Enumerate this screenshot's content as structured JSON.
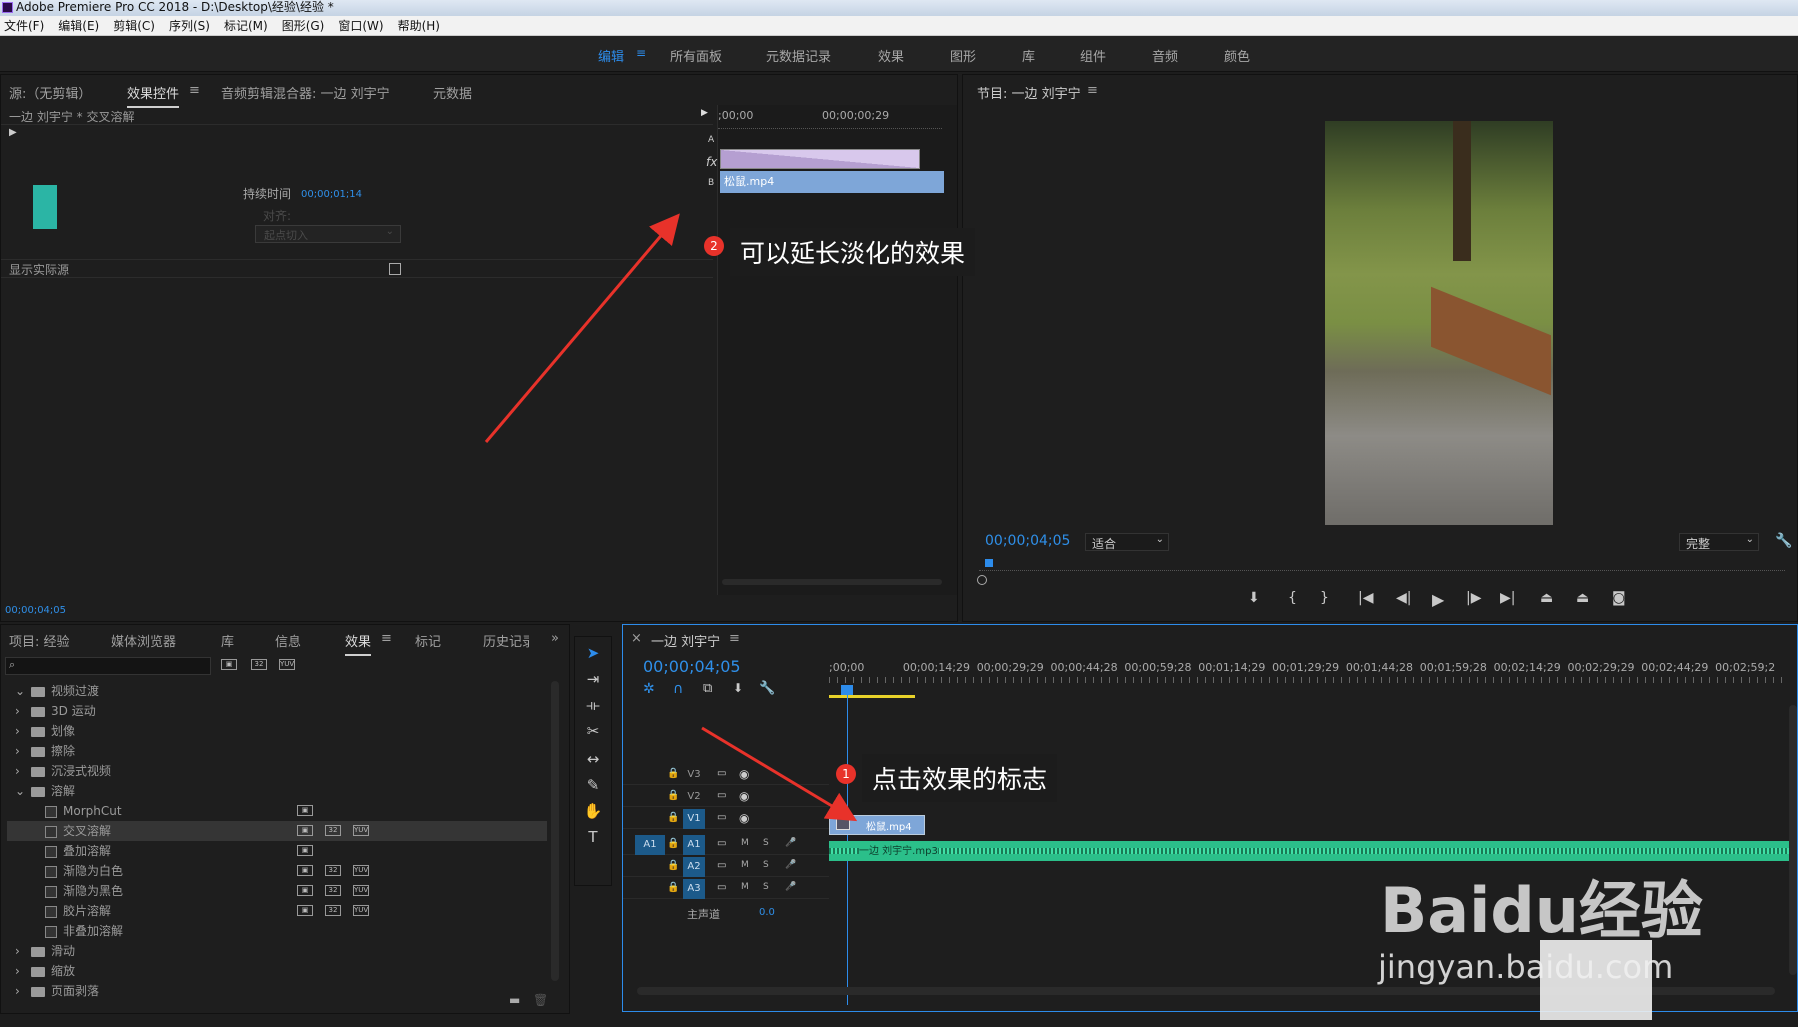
{
  "window": {
    "title": "Adobe Premiere Pro CC 2018 - D:\\Desktop\\经验\\经验 *"
  },
  "menu": [
    "文件(F)",
    "编辑(E)",
    "剪辑(C)",
    "序列(S)",
    "标记(M)",
    "图形(G)",
    "窗口(W)",
    "帮助(H)"
  ],
  "workspaces": [
    "编辑",
    "所有面板",
    "元数据记录",
    "效果",
    "图形",
    "库",
    "组件",
    "音频",
    "颜色"
  ],
  "source_panel": {
    "tabs": [
      "源:（无剪辑）",
      "效果控件",
      "音频剪辑混合器: 一边 刘宇宁",
      "元数据"
    ],
    "clip_title": "一边 刘宇宁 * 交叉溶解",
    "duration_label": "持续时间",
    "duration_value": "00;00;01;14",
    "align_label": "对齐:",
    "align_value": "起点切入",
    "show_source_label": "显示实际源",
    "ruler_start": ";00;00",
    "ruler_end": "00;00;00;29",
    "track_a": "A",
    "track_b": "B",
    "fx_label": "fx",
    "clip_name": "松鼠.mp4",
    "timecode": "00;00;04;05"
  },
  "program_panel": {
    "title": "节目: 一边 刘宇宁",
    "timecode": "00;00;04;05",
    "fit_select": "适合",
    "quality_select": "完整"
  },
  "project_panel": {
    "tabs": [
      "项目: 经验",
      "媒体浏览器",
      "库",
      "信息",
      "效果",
      "标记",
      "历史记录"
    ],
    "tree": [
      {
        "label": "视频过渡",
        "type": "folder",
        "open": true
      },
      {
        "label": "3D 运动",
        "type": "folder"
      },
      {
        "label": "划像",
        "type": "folder"
      },
      {
        "label": "擦除",
        "type": "folder"
      },
      {
        "label": "沉浸式视频",
        "type": "folder"
      },
      {
        "label": "溶解",
        "type": "folder",
        "open": true
      },
      {
        "label": "MorphCut",
        "type": "fx"
      },
      {
        "label": "交叉溶解",
        "type": "fx",
        "selected": true
      },
      {
        "label": "叠加溶解",
        "type": "fx"
      },
      {
        "label": "渐隐为白色",
        "type": "fx"
      },
      {
        "label": "渐隐为黑色",
        "type": "fx"
      },
      {
        "label": "胶片溶解",
        "type": "fx"
      },
      {
        "label": "非叠加溶解",
        "type": "fx"
      },
      {
        "label": "滑动",
        "type": "folder"
      },
      {
        "label": "缩放",
        "type": "folder"
      },
      {
        "label": "页面剥落",
        "type": "folder"
      }
    ]
  },
  "timeline": {
    "title": "一边 刘宇宁",
    "timecode": "00;00;04;05",
    "ruler": [
      ";00;00",
      "00;00;14;29",
      "00;00;29;29",
      "00;00;44;28",
      "00;00;59;28",
      "00;01;14;29",
      "00;01;29;29",
      "00;01;44;28",
      "00;01;59;28",
      "00;02;14;29",
      "00;02;29;29",
      "00;02;44;29",
      "00;02;59;2"
    ],
    "tracks": [
      "V3",
      "V2",
      "V1",
      "A1",
      "A2",
      "A3"
    ],
    "master_label": "主声道",
    "master_value": "0.0",
    "video_clip": "松鼠.mp4",
    "audio_clip": "一边 刘宇宁.mp3",
    "source_patch": "A1"
  },
  "annotations": {
    "callout1": "点击效果的标志",
    "callout2": "可以延长淡化的效果",
    "badge1": "1",
    "badge2": "2"
  },
  "watermark": {
    "text": "Baidu经验",
    "url": "jingyan.baidu.com"
  },
  "colors": {
    "accent": "#2d8ceb",
    "video_clip": "#7ea6d8",
    "audio_clip": "#2bbf8a",
    "arrow": "#e8322a"
  }
}
